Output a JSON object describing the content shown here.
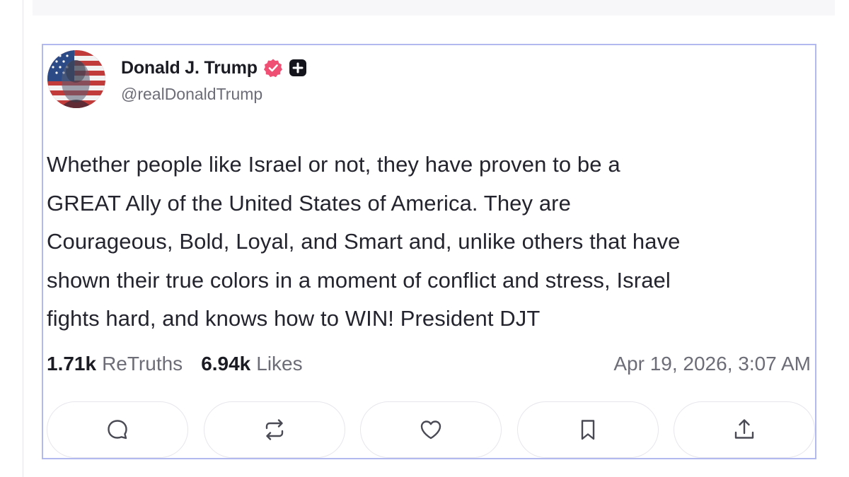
{
  "post": {
    "author": {
      "display_name": "Donald J. Trump",
      "handle": "@realDonaldTrump",
      "verified": true
    },
    "body_lines": [
      "Whether people like Israel or not, they have proven to be a",
      "GREAT Ally of the United States of America. They are",
      "Courageous, Bold, Loyal, and Smart and, unlike others that have",
      "shown their true colors in a moment of conflict and stress, Israel",
      "fights hard, and knows how to WIN! President DJT"
    ],
    "stats": {
      "retruths_count": "1.71k",
      "retruths_label": "ReTruths",
      "likes_count": "6.94k",
      "likes_label": "Likes"
    },
    "timestamp": "Apr 19, 2026, 3:07 AM"
  },
  "actions": [
    {
      "name": "reply",
      "icon": "chat-bubble-icon"
    },
    {
      "name": "retruth",
      "icon": "repost-icon"
    },
    {
      "name": "like",
      "icon": "heart-icon"
    },
    {
      "name": "bookmark",
      "icon": "bookmark-icon"
    },
    {
      "name": "share",
      "icon": "share-icon"
    }
  ],
  "colors": {
    "card_border": "#b2b9ef",
    "verified_badge": "#ef4f73",
    "muted_text": "#6d6d78",
    "body_text": "#24242e"
  }
}
